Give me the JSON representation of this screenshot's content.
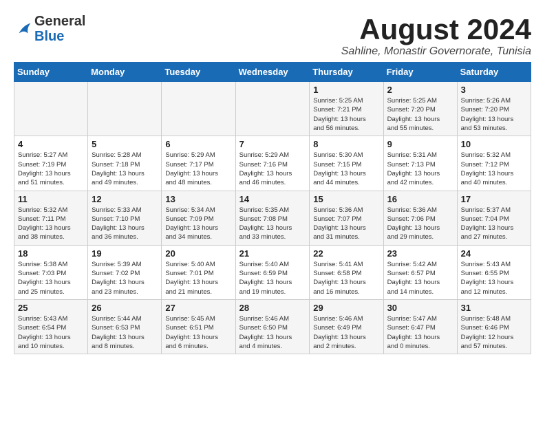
{
  "header": {
    "logo_general": "General",
    "logo_blue": "Blue",
    "title": "August 2024",
    "subtitle": "Sahline, Monastir Governorate, Tunisia"
  },
  "columns": [
    "Sunday",
    "Monday",
    "Tuesday",
    "Wednesday",
    "Thursday",
    "Friday",
    "Saturday"
  ],
  "weeks": [
    [
      {
        "day": "",
        "info": ""
      },
      {
        "day": "",
        "info": ""
      },
      {
        "day": "",
        "info": ""
      },
      {
        "day": "",
        "info": ""
      },
      {
        "day": "1",
        "info": "Sunrise: 5:25 AM\nSunset: 7:21 PM\nDaylight: 13 hours\nand 56 minutes."
      },
      {
        "day": "2",
        "info": "Sunrise: 5:25 AM\nSunset: 7:20 PM\nDaylight: 13 hours\nand 55 minutes."
      },
      {
        "day": "3",
        "info": "Sunrise: 5:26 AM\nSunset: 7:20 PM\nDaylight: 13 hours\nand 53 minutes."
      }
    ],
    [
      {
        "day": "4",
        "info": "Sunrise: 5:27 AM\nSunset: 7:19 PM\nDaylight: 13 hours\nand 51 minutes."
      },
      {
        "day": "5",
        "info": "Sunrise: 5:28 AM\nSunset: 7:18 PM\nDaylight: 13 hours\nand 49 minutes."
      },
      {
        "day": "6",
        "info": "Sunrise: 5:29 AM\nSunset: 7:17 PM\nDaylight: 13 hours\nand 48 minutes."
      },
      {
        "day": "7",
        "info": "Sunrise: 5:29 AM\nSunset: 7:16 PM\nDaylight: 13 hours\nand 46 minutes."
      },
      {
        "day": "8",
        "info": "Sunrise: 5:30 AM\nSunset: 7:15 PM\nDaylight: 13 hours\nand 44 minutes."
      },
      {
        "day": "9",
        "info": "Sunrise: 5:31 AM\nSunset: 7:13 PM\nDaylight: 13 hours\nand 42 minutes."
      },
      {
        "day": "10",
        "info": "Sunrise: 5:32 AM\nSunset: 7:12 PM\nDaylight: 13 hours\nand 40 minutes."
      }
    ],
    [
      {
        "day": "11",
        "info": "Sunrise: 5:32 AM\nSunset: 7:11 PM\nDaylight: 13 hours\nand 38 minutes."
      },
      {
        "day": "12",
        "info": "Sunrise: 5:33 AM\nSunset: 7:10 PM\nDaylight: 13 hours\nand 36 minutes."
      },
      {
        "day": "13",
        "info": "Sunrise: 5:34 AM\nSunset: 7:09 PM\nDaylight: 13 hours\nand 34 minutes."
      },
      {
        "day": "14",
        "info": "Sunrise: 5:35 AM\nSunset: 7:08 PM\nDaylight: 13 hours\nand 33 minutes."
      },
      {
        "day": "15",
        "info": "Sunrise: 5:36 AM\nSunset: 7:07 PM\nDaylight: 13 hours\nand 31 minutes."
      },
      {
        "day": "16",
        "info": "Sunrise: 5:36 AM\nSunset: 7:06 PM\nDaylight: 13 hours\nand 29 minutes."
      },
      {
        "day": "17",
        "info": "Sunrise: 5:37 AM\nSunset: 7:04 PM\nDaylight: 13 hours\nand 27 minutes."
      }
    ],
    [
      {
        "day": "18",
        "info": "Sunrise: 5:38 AM\nSunset: 7:03 PM\nDaylight: 13 hours\nand 25 minutes."
      },
      {
        "day": "19",
        "info": "Sunrise: 5:39 AM\nSunset: 7:02 PM\nDaylight: 13 hours\nand 23 minutes."
      },
      {
        "day": "20",
        "info": "Sunrise: 5:40 AM\nSunset: 7:01 PM\nDaylight: 13 hours\nand 21 minutes."
      },
      {
        "day": "21",
        "info": "Sunrise: 5:40 AM\nSunset: 6:59 PM\nDaylight: 13 hours\nand 19 minutes."
      },
      {
        "day": "22",
        "info": "Sunrise: 5:41 AM\nSunset: 6:58 PM\nDaylight: 13 hours\nand 16 minutes."
      },
      {
        "day": "23",
        "info": "Sunrise: 5:42 AM\nSunset: 6:57 PM\nDaylight: 13 hours\nand 14 minutes."
      },
      {
        "day": "24",
        "info": "Sunrise: 5:43 AM\nSunset: 6:55 PM\nDaylight: 13 hours\nand 12 minutes."
      }
    ],
    [
      {
        "day": "25",
        "info": "Sunrise: 5:43 AM\nSunset: 6:54 PM\nDaylight: 13 hours\nand 10 minutes."
      },
      {
        "day": "26",
        "info": "Sunrise: 5:44 AM\nSunset: 6:53 PM\nDaylight: 13 hours\nand 8 minutes."
      },
      {
        "day": "27",
        "info": "Sunrise: 5:45 AM\nSunset: 6:51 PM\nDaylight: 13 hours\nand 6 minutes."
      },
      {
        "day": "28",
        "info": "Sunrise: 5:46 AM\nSunset: 6:50 PM\nDaylight: 13 hours\nand 4 minutes."
      },
      {
        "day": "29",
        "info": "Sunrise: 5:46 AM\nSunset: 6:49 PM\nDaylight: 13 hours\nand 2 minutes."
      },
      {
        "day": "30",
        "info": "Sunrise: 5:47 AM\nSunset: 6:47 PM\nDaylight: 13 hours\nand 0 minutes."
      },
      {
        "day": "31",
        "info": "Sunrise: 5:48 AM\nSunset: 6:46 PM\nDaylight: 12 hours\nand 57 minutes."
      }
    ]
  ]
}
